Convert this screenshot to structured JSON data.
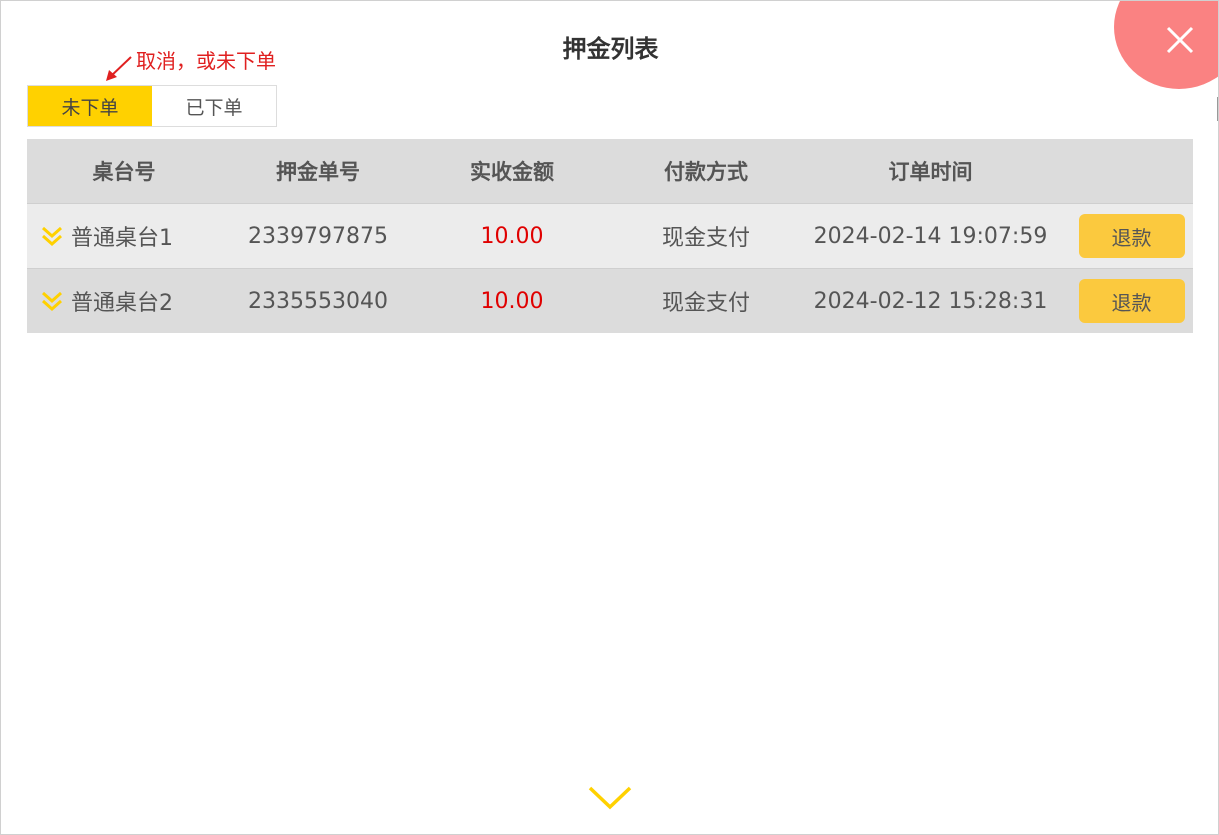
{
  "dialog": {
    "title": "押金列表"
  },
  "annotation": {
    "text": "取消，或未下单",
    "color": "#e02020"
  },
  "tabs": [
    {
      "label": "未下单",
      "active": true
    },
    {
      "label": "已下单",
      "active": false
    }
  ],
  "table": {
    "headers": [
      "桌台号",
      "押金单号",
      "实收金额",
      "付款方式",
      "订单时间"
    ],
    "rows": [
      {
        "table_no": "普通桌台1",
        "order_no": "2339797875",
        "amount": "10.00",
        "payment": "现金支付",
        "time": "2024-02-14 19:07:59",
        "action": "退款"
      },
      {
        "table_no": "普通桌台2",
        "order_no": "2335553040",
        "amount": "10.00",
        "payment": "现金支付",
        "time": "2024-02-12 15:28:31",
        "action": "退款"
      }
    ]
  },
  "colors": {
    "accent": "#ffd100",
    "refund_button": "#fbc93e",
    "close_circle": "#fa8282",
    "amount": "#e00000"
  },
  "icons": {
    "close": "close-icon",
    "expand": "double-chevron-down-icon",
    "more": "chevron-down-icon"
  }
}
